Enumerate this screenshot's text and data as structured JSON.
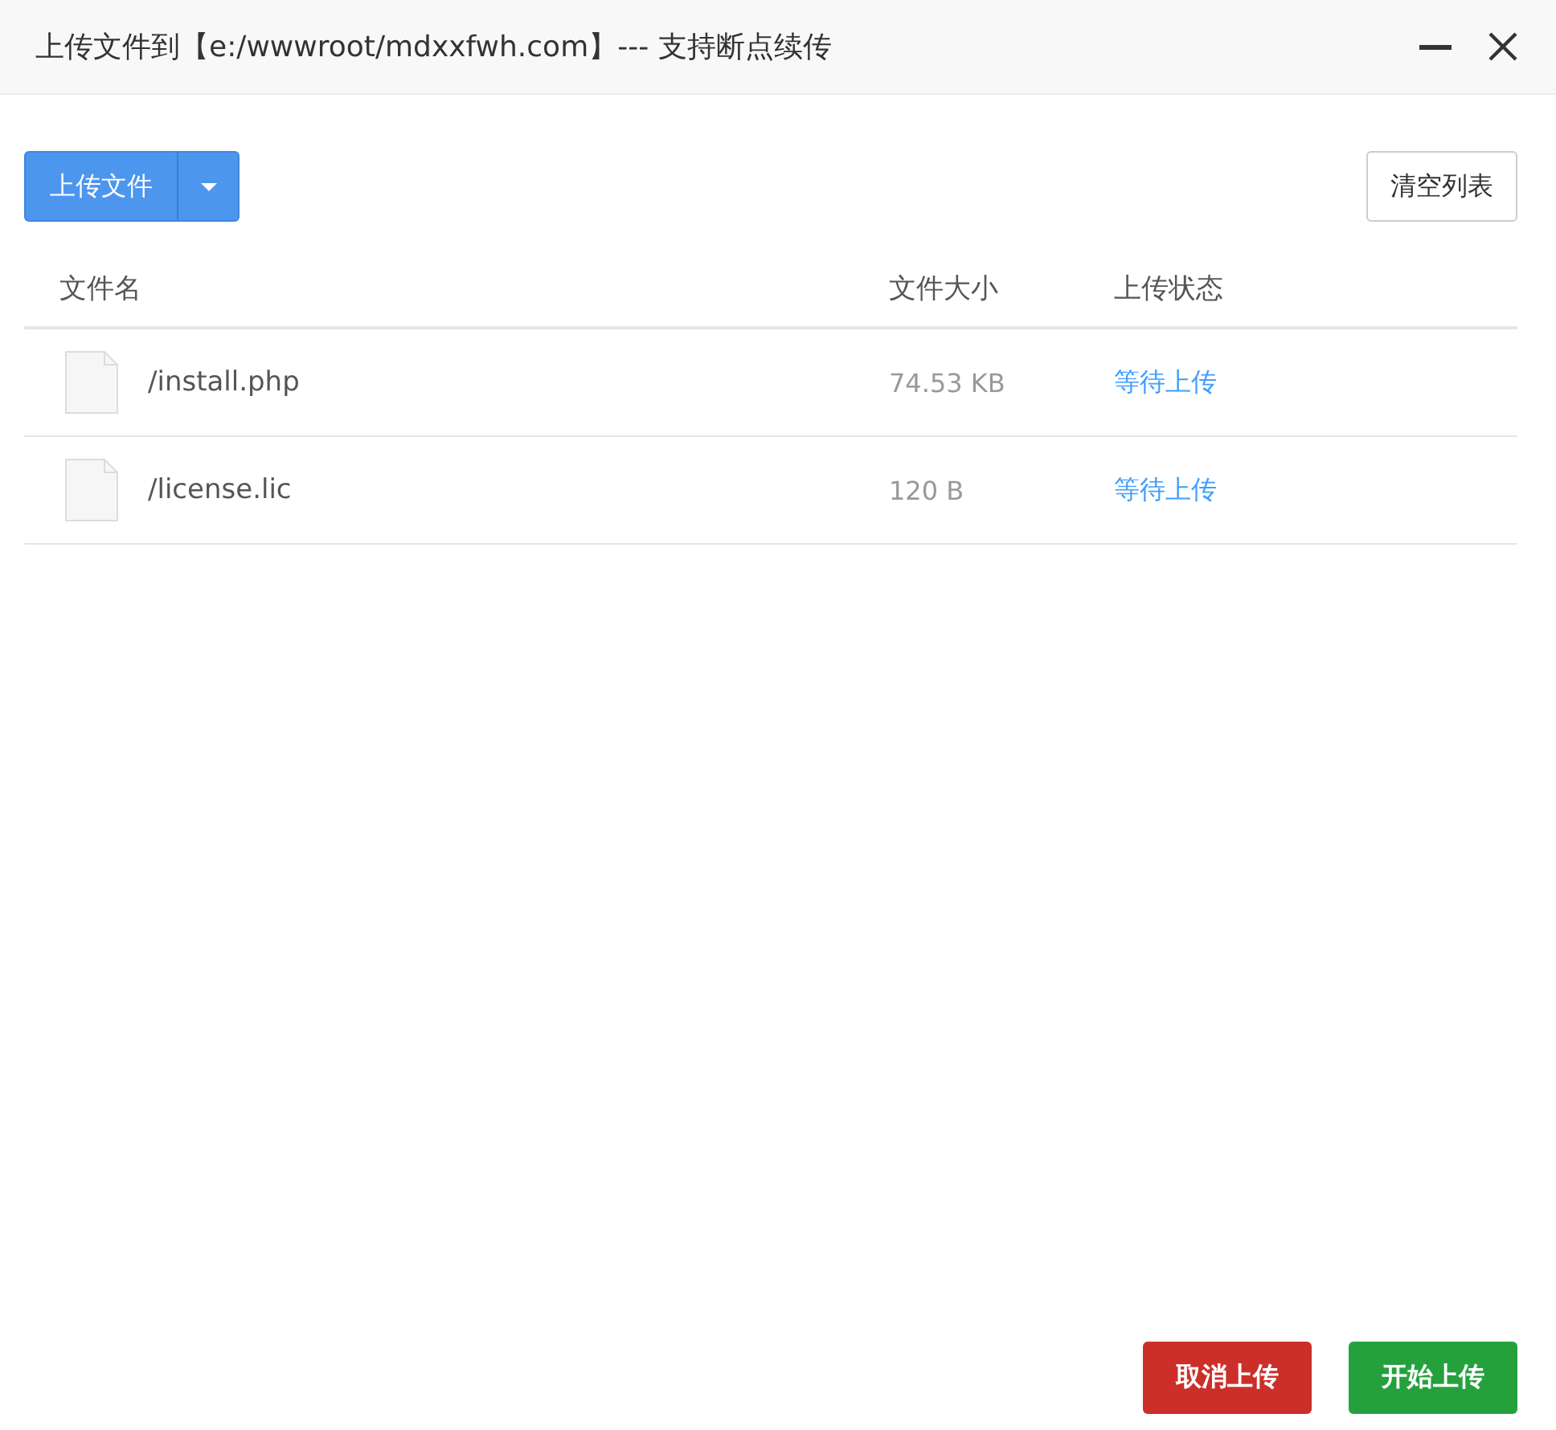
{
  "window": {
    "title": "上传文件到【e:/wwwroot/mdxxfwh.com】--- 支持断点续传"
  },
  "toolbar": {
    "upload_button": "上传文件",
    "clear_button": "清空列表"
  },
  "table": {
    "columns": [
      "文件名",
      "文件大小",
      "上传状态"
    ],
    "rows": [
      {
        "name": "/install.php",
        "size": "74.53 KB",
        "status": "等待上传"
      },
      {
        "name": "/license.lic",
        "size": "120 B",
        "status": "等待上传"
      }
    ]
  },
  "footer_buttons": [
    {
      "label": "取消上传",
      "kind": "cancel"
    },
    {
      "label": "开始上传",
      "kind": "start"
    }
  ]
}
